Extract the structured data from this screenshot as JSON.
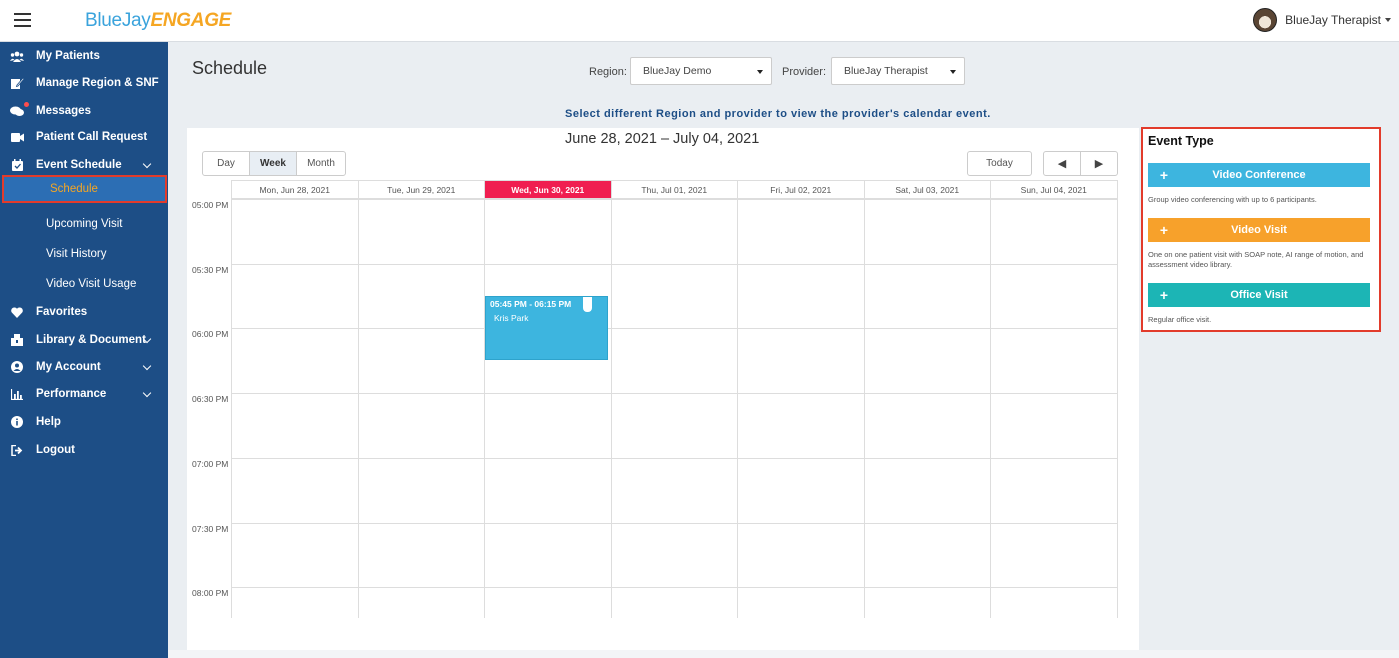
{
  "topbar": {
    "logo_part1": "BlueJay",
    "logo_part2": "ENGAGE",
    "user_name": "BlueJay Therapist"
  },
  "sidebar": {
    "items": [
      {
        "label": "My Patients",
        "icon": "users-icon"
      },
      {
        "label": "Manage Region & SNF",
        "icon": "edit-icon"
      },
      {
        "label": "Messages",
        "icon": "chat-icon"
      },
      {
        "label": "Patient Call Request",
        "icon": "video-camera-icon"
      },
      {
        "label": "Event Schedule",
        "icon": "calendar-icon"
      },
      {
        "label": "Favorites",
        "icon": "heart-icon"
      },
      {
        "label": "Library & Document",
        "icon": "library-icon"
      },
      {
        "label": "My Account",
        "icon": "user-circle-icon"
      },
      {
        "label": "Performance",
        "icon": "bar-chart-icon"
      },
      {
        "label": "Help",
        "icon": "info-icon"
      },
      {
        "label": "Logout",
        "icon": "logout-icon"
      }
    ],
    "sub_items": [
      "Schedule",
      "Upcoming Visit",
      "Visit History",
      "Video Visit Usage"
    ]
  },
  "page": {
    "title": "Schedule",
    "region_label": "Region:",
    "region_value": "BlueJay Demo",
    "provider_label": "Provider:",
    "provider_value": "BlueJay Therapist",
    "hint": "Select different Region and provider to view the provider's calendar event."
  },
  "calendar": {
    "date_range": "June 28, 2021 – July 04, 2021",
    "views": [
      "Day",
      "Week",
      "Month"
    ],
    "active_view": "Week",
    "today_label": "Today",
    "prev_symbol": "◀",
    "next_symbol": "▶",
    "days": [
      "Mon, Jun 28, 2021",
      "Tue, Jun 29, 2021",
      "Wed, Jun 30, 2021",
      "Thu, Jul 01, 2021",
      "Fri, Jul 02, 2021",
      "Sat, Jul 03, 2021",
      "Sun, Jul 04, 2021"
    ],
    "today_index": 2,
    "times": [
      "05:00 PM",
      "05:30 PM",
      "06:00 PM",
      "06:30 PM",
      "07:00 PM",
      "07:30 PM",
      "08:00 PM"
    ],
    "event": {
      "time": "05:45 PM - 06:15 PM",
      "name": "Kris Park",
      "color": "#3db5df"
    }
  },
  "event_type": {
    "title": "Event Type",
    "types": [
      {
        "label": "Video Conference",
        "desc": "Group video conferencing with up to 6 participants.",
        "color": "#3db5df"
      },
      {
        "label": "Video Visit",
        "desc": "One on one patient visit with SOAP note, AI range of motion, and assessment video library.",
        "color": "#f7a12b"
      },
      {
        "label": "Office Visit",
        "desc": "Regular office visit.",
        "color": "#1cb5b5"
      }
    ]
  },
  "colors": {
    "sidebar": "#1d4e86",
    "accent": "#f5a623",
    "today": "#f01e50",
    "highlight_border": "#e23b2b"
  }
}
